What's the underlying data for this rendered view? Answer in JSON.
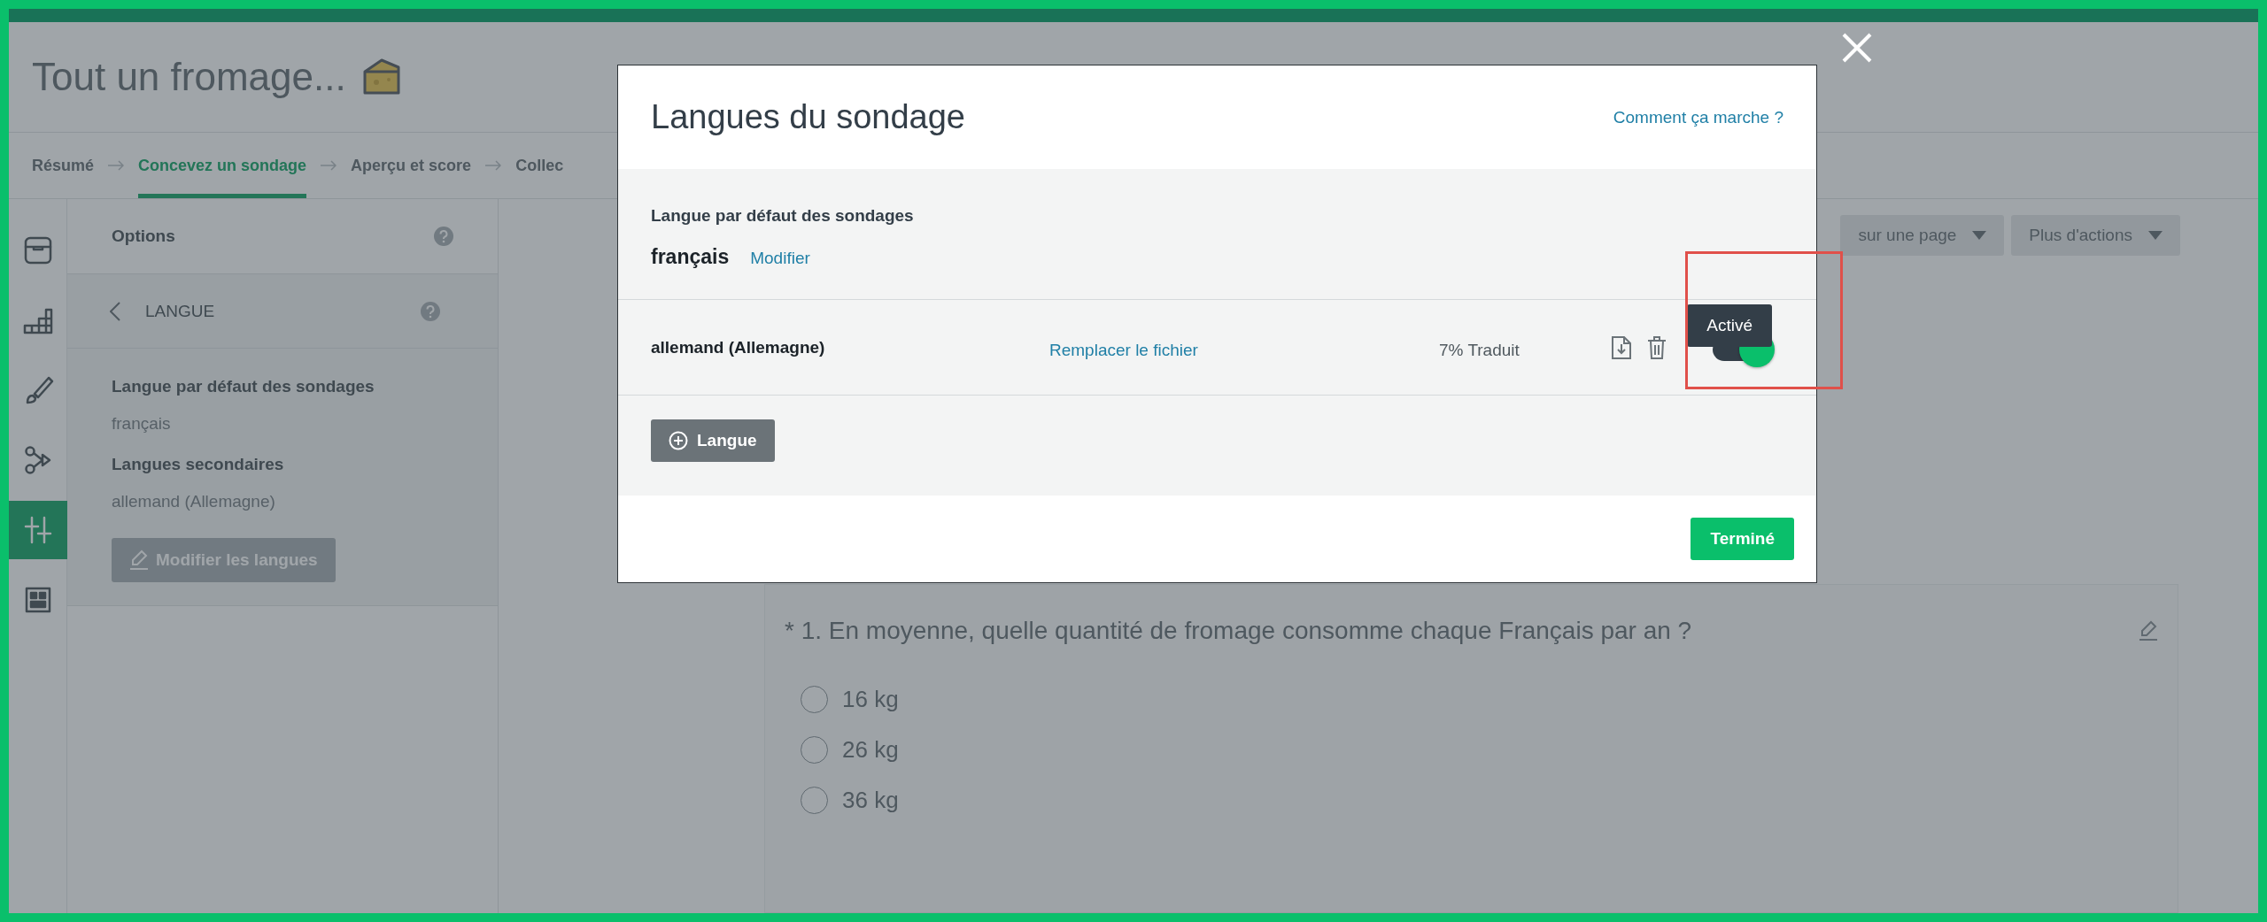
{
  "survey_title": "Tout un fromage...",
  "steps": [
    {
      "label": "Résumé",
      "selected": false
    },
    {
      "label": "Concevez un sondage",
      "selected": true
    },
    {
      "label": "Aperçu et score",
      "selected": false
    },
    {
      "label": "Collec",
      "selected": false
    }
  ],
  "rail": [
    {
      "kind": "tray",
      "selected": false
    },
    {
      "kind": "blocks",
      "selected": false
    },
    {
      "kind": "brush",
      "selected": false
    },
    {
      "kind": "logic",
      "selected": false
    },
    {
      "kind": "sliders",
      "selected": true
    },
    {
      "kind": "layout",
      "selected": false
    }
  ],
  "sidebar": {
    "title": "Options",
    "section": "LANGUE",
    "default_label": "Langue par défaut des sondages",
    "default_value": "français",
    "secondary_label": "Langues secondaires",
    "secondary_value": "allemand (Allemagne)",
    "button": "Modifier les langues"
  },
  "toolbar": [
    "sur une page",
    "Plus d'actions"
  ],
  "question": {
    "text": "* 1. En moyenne, quelle quantité de fromage consomme chaque Français par an ?",
    "options": [
      {
        "label": "16 kg",
        "selected": false
      },
      {
        "label": "26 kg",
        "selected": false
      },
      {
        "label": "36 kg",
        "selected": false
      }
    ]
  },
  "modal": {
    "title": "Langues du sondage",
    "help_link": "Comment ça marche ?",
    "default_label": "Langue par défaut des sondages",
    "default_language": "français",
    "modify_link": "Modifier",
    "languages": [
      {
        "name": "allemand (Allemagne)",
        "replace_link": "Remplacer le fichier",
        "progress": "7% Traduit",
        "on": true
      }
    ],
    "tooltip": "Activé",
    "add_button": "Langue",
    "done_button": "Terminé"
  }
}
